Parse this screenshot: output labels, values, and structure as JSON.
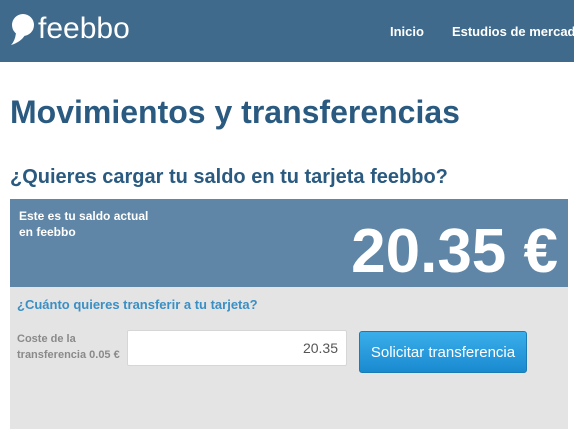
{
  "header": {
    "logo_text": "feebbo",
    "nav": [
      {
        "label": "Inicio"
      },
      {
        "label": "Estudios de mercado"
      }
    ]
  },
  "main": {
    "title": "Movimientos y transferencias",
    "subtitle": "¿Quieres cargar tu saldo en tu tarjeta feebbo?",
    "balance": {
      "label": "Este es tu saldo actual en feebbo",
      "amount": "20.35 €"
    },
    "transfer": {
      "question": "¿Cuánto quieres transferir a tu tarjeta?",
      "cost_label": "Coste de la transferencia 0.05 €",
      "amount_value": "20.35",
      "submit_label": "Solicitar transferencia"
    }
  },
  "colors": {
    "header_bg": "#3f6a8c",
    "heading": "#2a5a80",
    "balance_bg": "#5f86a6",
    "link_blue": "#3a8fc4",
    "button_blue": "#1a8ad0"
  },
  "icons": {
    "logo": "speech-drop-icon"
  }
}
